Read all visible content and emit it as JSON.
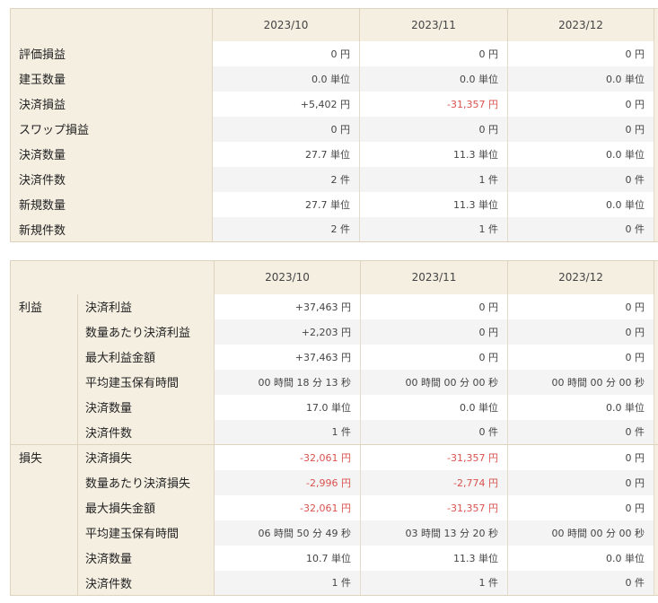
{
  "summary": {
    "months": [
      "2023/10",
      "2023/11",
      "2023/12"
    ],
    "rows": [
      {
        "label": "評価損益",
        "values": [
          "0 円",
          "0 円",
          "0 円"
        ],
        "neg": [
          false,
          false,
          false
        ]
      },
      {
        "label": "建玉数量",
        "values": [
          "0.0 単位",
          "0.0 単位",
          "0.0 単位"
        ],
        "neg": [
          false,
          false,
          false
        ]
      },
      {
        "label": "決済損益",
        "values": [
          "+5,402 円",
          "-31,357 円",
          "0 円"
        ],
        "neg": [
          false,
          true,
          false
        ]
      },
      {
        "label": "スワップ損益",
        "values": [
          "0 円",
          "0 円",
          "0 円"
        ],
        "neg": [
          false,
          false,
          false
        ]
      },
      {
        "label": "決済数量",
        "values": [
          "27.7 単位",
          "11.3 単位",
          "0.0 単位"
        ],
        "neg": [
          false,
          false,
          false
        ]
      },
      {
        "label": "決済件数",
        "values": [
          "2 件",
          "1 件",
          "0 件"
        ],
        "neg": [
          false,
          false,
          false
        ]
      },
      {
        "label": "新規数量",
        "values": [
          "27.7 単位",
          "11.3 単位",
          "0.0 単位"
        ],
        "neg": [
          false,
          false,
          false
        ]
      },
      {
        "label": "新規件数",
        "values": [
          "2 件",
          "1 件",
          "0 件"
        ],
        "neg": [
          false,
          false,
          false
        ]
      }
    ]
  },
  "detail": {
    "months": [
      "2023/10",
      "2023/11",
      "2023/12"
    ],
    "groups": [
      {
        "label": "利益",
        "rows": [
          {
            "label": "決済利益",
            "values": [
              "+37,463 円",
              "0 円",
              "0 円"
            ],
            "neg": [
              false,
              false,
              false
            ]
          },
          {
            "label": "数量あたり決済利益",
            "values": [
              "+2,203 円",
              "0 円",
              "0 円"
            ],
            "neg": [
              false,
              false,
              false
            ]
          },
          {
            "label": "最大利益金額",
            "values": [
              "+37,463 円",
              "0 円",
              "0 円"
            ],
            "neg": [
              false,
              false,
              false
            ]
          },
          {
            "label": "平均建玉保有時間",
            "values": [
              "00 時間 18 分 13 秒",
              "00 時間 00 分 00 秒",
              "00 時間 00 分 00 秒"
            ],
            "neg": [
              false,
              false,
              false
            ]
          },
          {
            "label": "決済数量",
            "values": [
              "17.0 単位",
              "0.0 単位",
              "0.0 単位"
            ],
            "neg": [
              false,
              false,
              false
            ]
          },
          {
            "label": "決済件数",
            "values": [
              "1 件",
              "0 件",
              "0 件"
            ],
            "neg": [
              false,
              false,
              false
            ]
          }
        ]
      },
      {
        "label": "損失",
        "rows": [
          {
            "label": "決済損失",
            "values": [
              "-32,061 円",
              "-31,357 円",
              "0 円"
            ],
            "neg": [
              true,
              true,
              false
            ]
          },
          {
            "label": "数量あたり決済損失",
            "values": [
              "-2,996 円",
              "-2,774 円",
              "0 円"
            ],
            "neg": [
              true,
              true,
              false
            ]
          },
          {
            "label": "最大損失金額",
            "values": [
              "-32,061 円",
              "-31,357 円",
              "0 円"
            ],
            "neg": [
              true,
              true,
              false
            ]
          },
          {
            "label": "平均建玉保有時間",
            "values": [
              "06 時間 50 分 49 秒",
              "03 時間 13 分 20 秒",
              "00 時間 00 分 00 秒"
            ],
            "neg": [
              false,
              false,
              false
            ]
          },
          {
            "label": "決済数量",
            "values": [
              "10.7 単位",
              "11.3 単位",
              "0.0 単位"
            ],
            "neg": [
              false,
              false,
              false
            ]
          },
          {
            "label": "決済件数",
            "values": [
              "1 件",
              "1 件",
              "0 件"
            ],
            "neg": [
              false,
              false,
              false
            ]
          }
        ]
      }
    ]
  },
  "colors": {
    "negative": "#d9534f",
    "header_bg": "#f5efe2",
    "stripe": "#f4f4f4"
  }
}
